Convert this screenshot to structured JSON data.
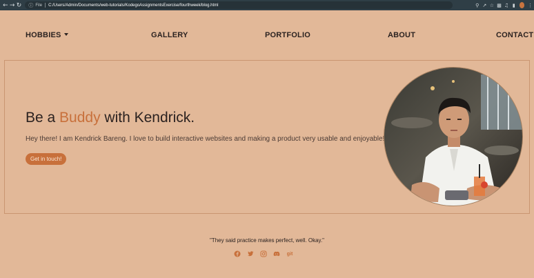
{
  "browser": {
    "back_icon": "arrow-left-icon",
    "forward_icon": "arrow-right-icon",
    "reload_icon": "reload-icon",
    "address": {
      "scheme_label": "File",
      "url": "C:/Users/Admin/Documents/web-tutorials/KodegoAssignmentsExercise/fourthweek/blog.html"
    }
  },
  "nav": {
    "items": [
      {
        "label": "HOBBIES"
      },
      {
        "label": "GALLERY"
      },
      {
        "label": "PORTFOLIO"
      },
      {
        "label": "ABOUT"
      },
      {
        "label": "CONTACT"
      }
    ]
  },
  "hero": {
    "title_pre": "Be a ",
    "title_highlight": "Buddy",
    "title_post": " with Kendrick.",
    "subtitle": "Hey there! I am Kendrick Bareng. I love to build interactive websites and making a product very usable and enjoyable!",
    "cta_label": "Get in touch!"
  },
  "footer": {
    "quote": "\"They said practice makes perfect, well. Okay.\"",
    "socials": [
      "facebook-icon",
      "twitter-icon",
      "instagram-icon",
      "discord-icon",
      "git-icon"
    ],
    "git_label": "git"
  },
  "colors": {
    "background": "#e2b898",
    "accent": "#c8703b",
    "text": "#2b2220",
    "browser_bar": "#2f3e46"
  }
}
